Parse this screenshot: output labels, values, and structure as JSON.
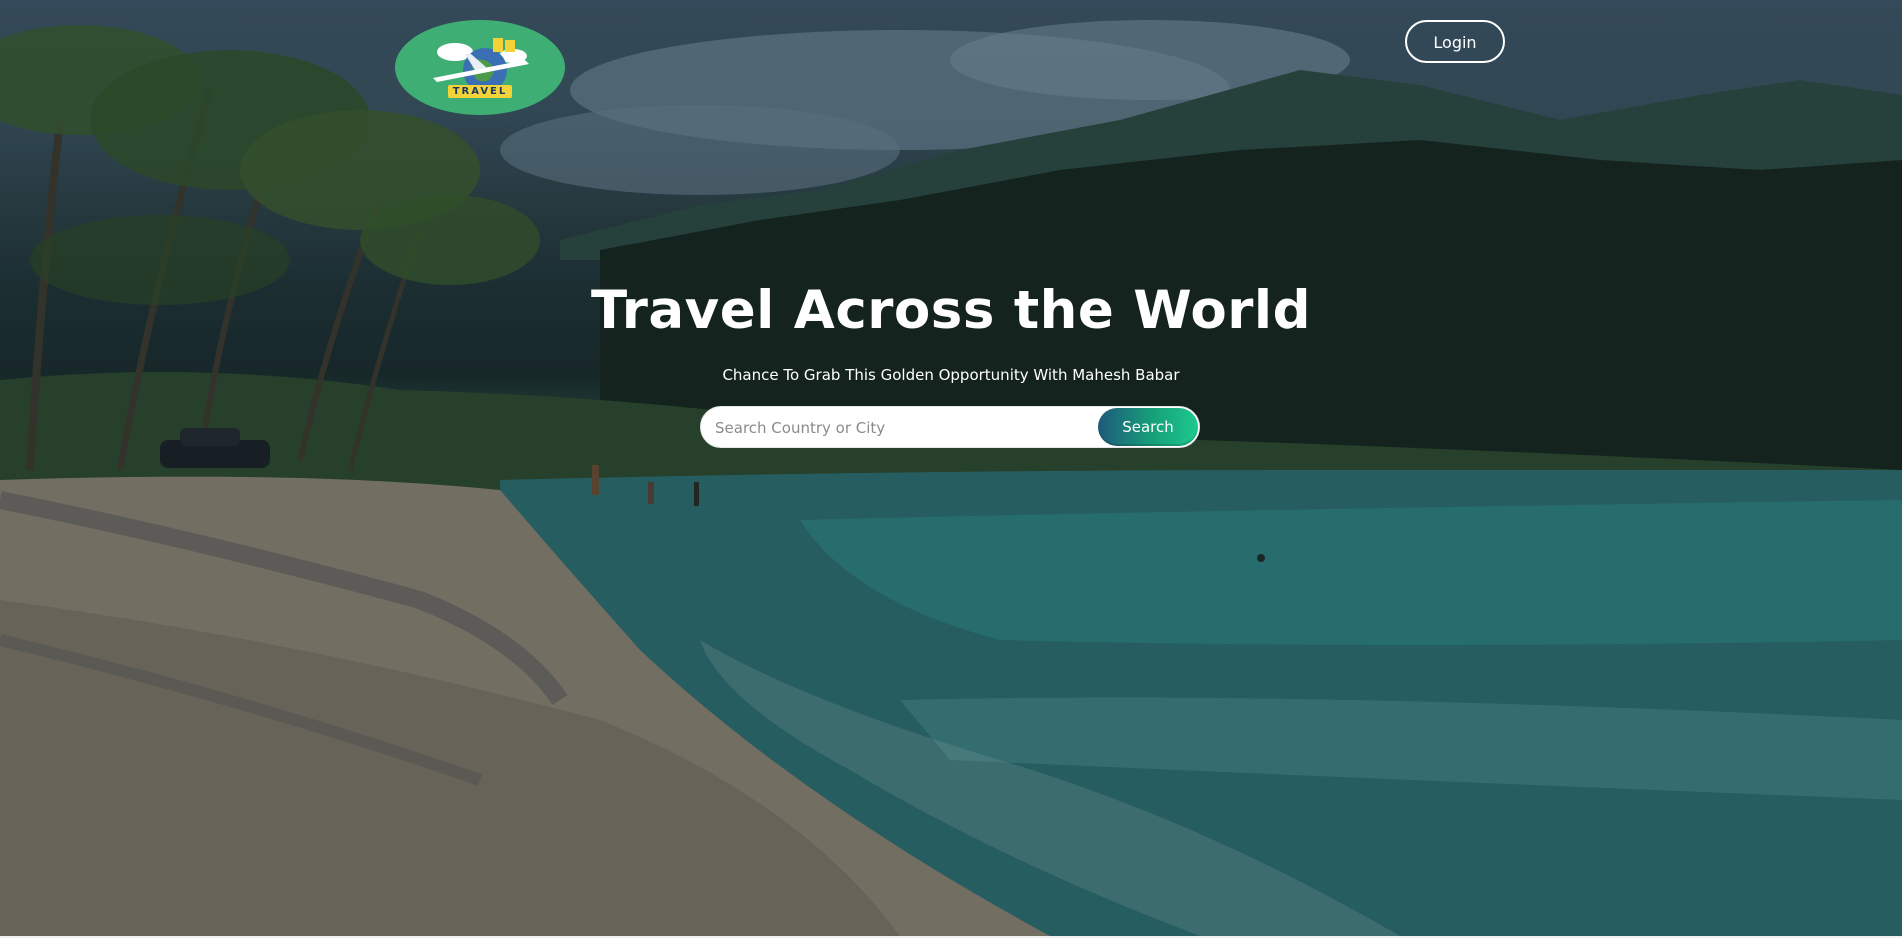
{
  "header": {
    "logo_text": "TRAVEL",
    "login_label": "Login"
  },
  "hero": {
    "title": "Travel Across the World",
    "subtitle": "Chance To Grab This Golden Opportunity With Mahesh Babar"
  },
  "search": {
    "placeholder": "Search Country or City",
    "value": "",
    "button_label": "Search"
  },
  "colors": {
    "logo_background": "#3fae74",
    "search_button_start": "#1f5a7a",
    "search_button_end": "#1ec98d",
    "text": "#ffffff"
  },
  "icons": {
    "logo": "globe-airplane-logo-icon"
  }
}
